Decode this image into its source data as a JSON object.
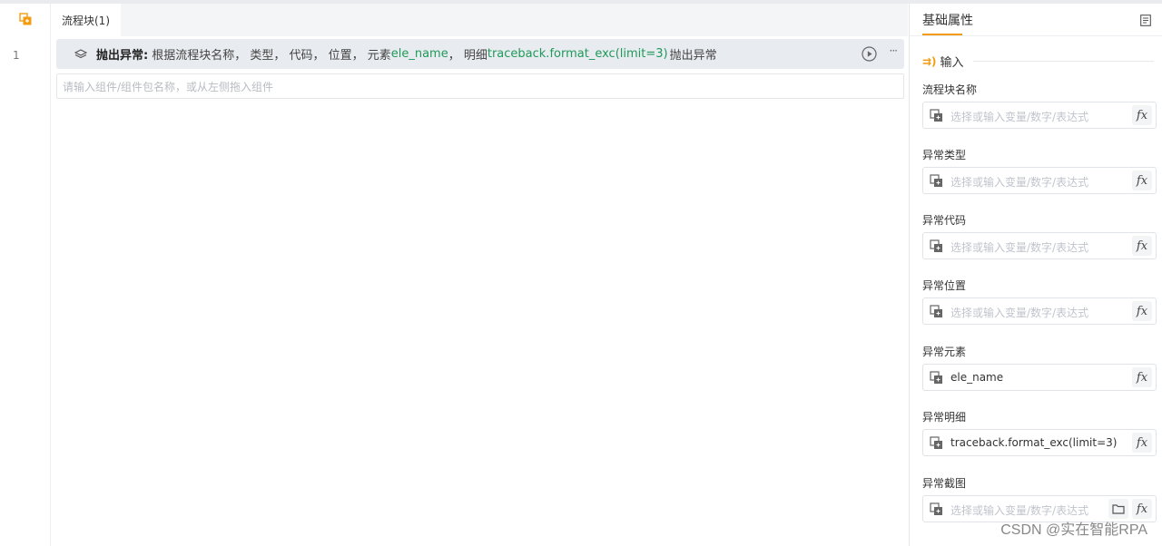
{
  "tab": {
    "label": "流程块(1)"
  },
  "editor": {
    "line_number": "1",
    "step": {
      "title": "抛出异常:",
      "parts": [
        "根据流程块名称， 类型， 代码， 位置， 元素",
        "ele_name",
        "， 明细",
        "traceback.format_exc(limit=3)",
        "抛出异常"
      ]
    },
    "add_placeholder": "请输入组件/组件包名称，或从左侧拖入组件"
  },
  "panel": {
    "title": "基础属性",
    "section": "输入",
    "section_arrow": "⇉)",
    "fields": [
      {
        "label": "流程块名称",
        "value": "",
        "placeholder": "选择或输入变量/数字/表达式"
      },
      {
        "label": "异常类型",
        "value": "",
        "placeholder": "选择或输入变量/数字/表达式"
      },
      {
        "label": "异常代码",
        "value": "",
        "placeholder": "选择或输入变量/数字/表达式"
      },
      {
        "label": "异常位置",
        "value": "",
        "placeholder": "选择或输入变量/数字/表达式"
      },
      {
        "label": "异常元素",
        "value": "ele_name",
        "placeholder": ""
      },
      {
        "label": "异常明细",
        "value": "traceback.format_exc(limit=3)",
        "placeholder": ""
      },
      {
        "label": "异常截图",
        "value": "",
        "placeholder": "选择或输入变量/数字/表达式"
      }
    ],
    "fx_label": "fx"
  },
  "watermark": "CSDN @实在智能RPA",
  "colors": {
    "accent": "#f39c12",
    "green": "#1f9a5a"
  }
}
